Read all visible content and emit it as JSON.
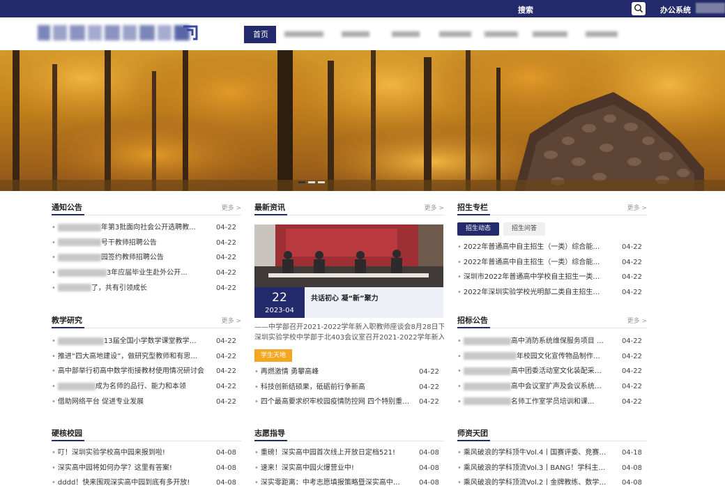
{
  "topbar": {
    "search_label": "搜索",
    "office_label": "办公系统"
  },
  "nav": {
    "items": [
      "首页"
    ]
  },
  "sections": {
    "notice": {
      "title": "通知公告",
      "more": "更多 >",
      "items": [
        {
          "title": "年第3批面向社会公开选聘教...",
          "date": "04-22"
        },
        {
          "title": "号干教师招聘公告",
          "date": "04-22"
        },
        {
          "title": "园签约教师招聘公告",
          "date": "04-22"
        },
        {
          "title": "3年应届毕业生赴外公开...",
          "date": "04-22"
        },
        {
          "title": "了，共有引领成长",
          "date": "04-22"
        }
      ]
    },
    "latest": {
      "title": "最新资讯",
      "more": "更多 >",
      "featured": {
        "day": "22",
        "ym": "2023-04",
        "title": "共话初心 凝“新”聚力"
      },
      "summary_lines": [
        "——中学部召开2021-2022学年新入职教师座谈会8月28日下午,",
        "深圳实验学校中学部于北403会议室召开2021-2022学年新入职..."
      ],
      "tag": "学生天地",
      "items": [
        {
          "title": "再燃激情 勇攀高峰",
          "date": "04-22"
        },
        {
          "title": "科技创新结硕果，砥砺前行争新高",
          "date": "04-22"
        },
        {
          "title": "四个最高要求织牢校园疫情防控网 四个特别重视...",
          "date": "04-22"
        }
      ]
    },
    "admission": {
      "title": "招生专栏",
      "more": "更多 >",
      "tabs": [
        "招生动态",
        "招生问答"
      ],
      "items": [
        {
          "title": "2022年普通高中自主招生（一类）综合能力考...",
          "date": "04-22"
        },
        {
          "title": "2022年普通高中自主招生（一类）综合能力考...",
          "date": "04-22"
        },
        {
          "title": "深圳市2022年普通高中学校自主招生一类考生...",
          "date": "04-22"
        },
        {
          "title": "2022年深圳实验学校光明部二类自主招生专项...",
          "date": "04-22"
        }
      ]
    },
    "research": {
      "title": "教学研究",
      "more": "更多 >",
      "items": [
        {
          "title": "13届全国小学数学课堂教学比...",
          "date": "04-22"
        },
        {
          "title": "推进“四大高地建设”，做研究型教师和有思想...",
          "date": "04-22"
        },
        {
          "title": "高中部举行初高中数学衔接教材使用情况研讨会",
          "date": "04-22"
        },
        {
          "title": "成为名师的品行、能力和本领",
          "date": "04-22"
        },
        {
          "title": "借助网络平台 促进专业发展",
          "date": "04-22"
        }
      ]
    },
    "bidding": {
      "title": "招标公告",
      "more": "更多 >",
      "items": [
        {
          "title": "高中消防系统维保服务项目 ...",
          "date": "04-22"
        },
        {
          "title": "年校园文化宣传物品制作服...",
          "date": "04-22"
        },
        {
          "title": "高中团委活动室文化装配采购...",
          "date": "04-22"
        },
        {
          "title": "高中会议室扩声及会议系统采...",
          "date": "04-22"
        },
        {
          "title": "名师工作室学员培训和课...",
          "date": "04-22"
        }
      ]
    },
    "campus": {
      "title": "硬核校园",
      "items": [
        {
          "title": "叮！深圳实验学校高中园来报到啦!",
          "date": "04-08"
        },
        {
          "title": "深实高中园将如何办学？这里有答案!",
          "date": "04-08"
        },
        {
          "title": "dddd！快来围观深实高中园到底有多开放!",
          "date": "04-08"
        }
      ]
    },
    "volunteer": {
      "title": "志愿指导",
      "items": [
        {
          "title": "重磅！深实高中园首次线上开放日定档521!",
          "date": "04-08"
        },
        {
          "title": "速来！深实高中园火爆营业中!",
          "date": "04-08"
        },
        {
          "title": "深实零距离：中考志愿填报策略暨深实高中园招...",
          "date": "04-08"
        }
      ]
    },
    "teachers": {
      "title": "师资天团",
      "items": [
        {
          "title": "乘风破浪的学科顶牛Vol.4丨国赛评委、竞赛教...",
          "date": "04-18"
        },
        {
          "title": "乘风破浪的学科顶流Vol.3丨BANG！学科主任...",
          "date": "04-08"
        },
        {
          "title": "乘风破浪的学科顶流Vol.2丨金牌教练、数学名...",
          "date": "04-08"
        }
      ]
    }
  },
  "colors": {
    "primary": "#232a6b",
    "accent": "#f5a623"
  }
}
